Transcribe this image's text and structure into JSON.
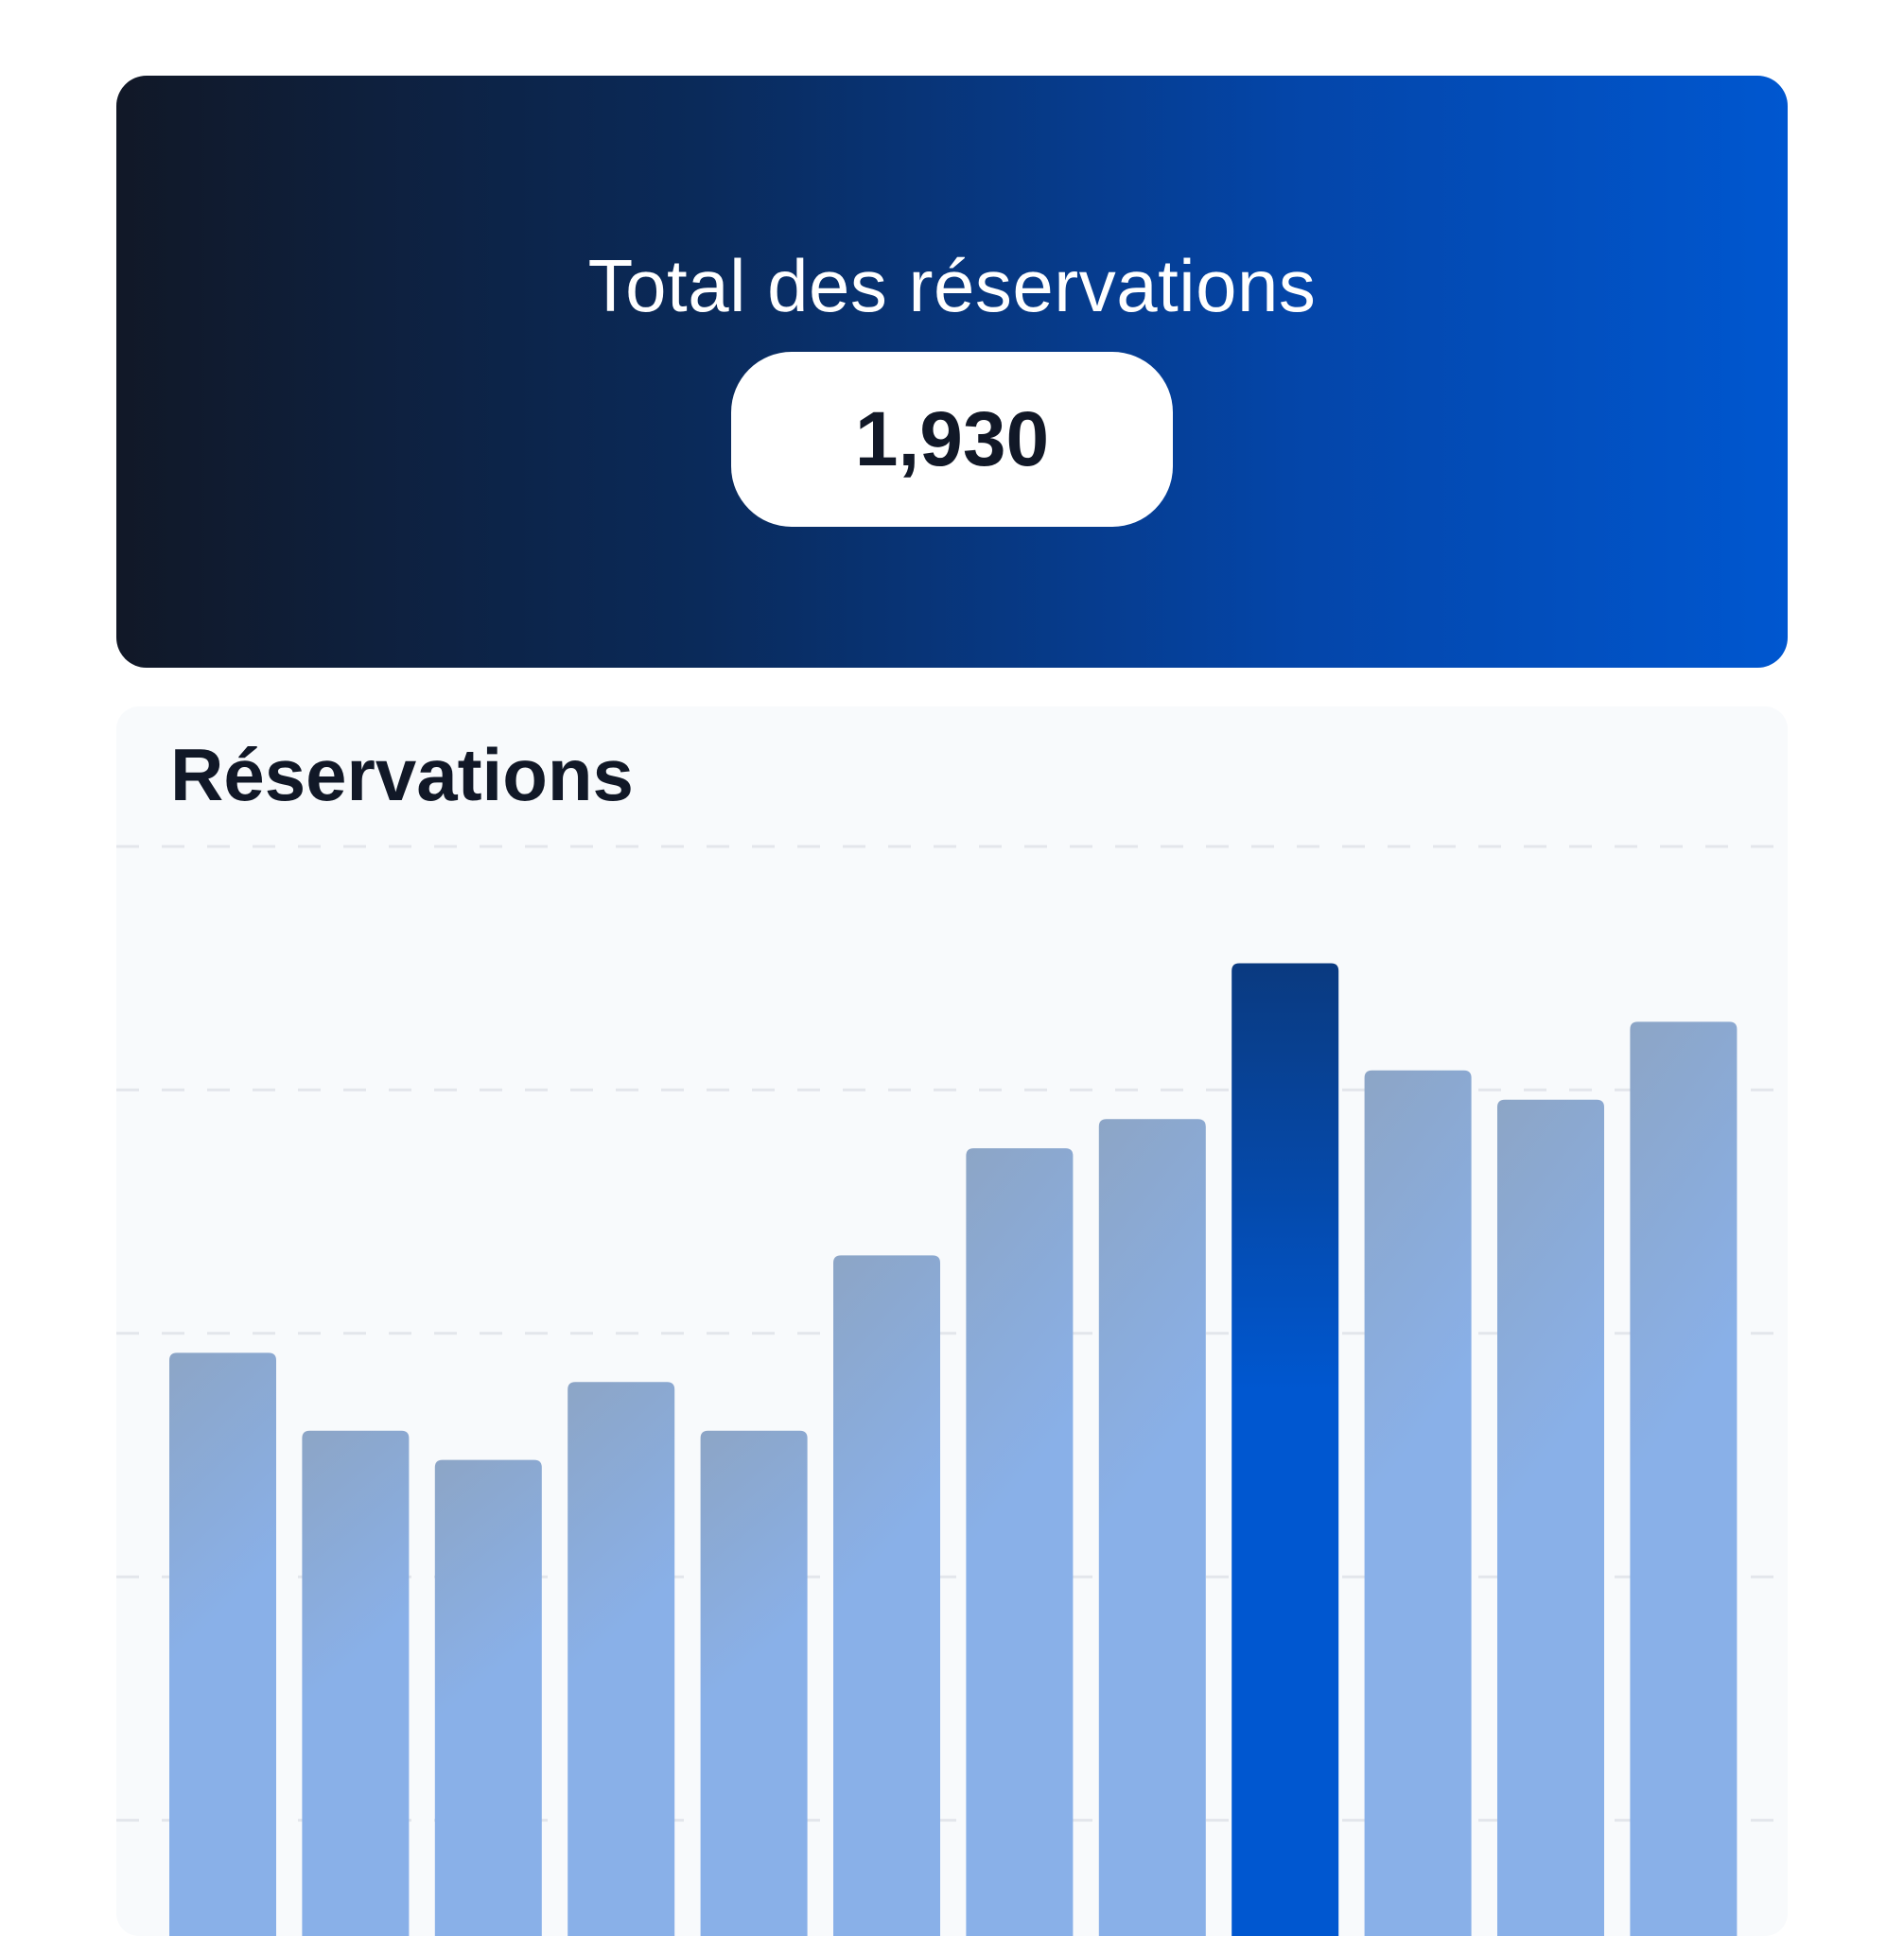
{
  "hero": {
    "title": "Total des réservations",
    "total": "1,930",
    "gradient": [
      "#111827",
      "#0057d0"
    ]
  },
  "chart_data": {
    "type": "bar",
    "title": "Réservations",
    "values": [
      148,
      140,
      137,
      145,
      140,
      158,
      169,
      172,
      188,
      177,
      174,
      182
    ],
    "highlight_index": 8,
    "ylim": [
      0,
      200
    ],
    "grid": true,
    "grid_step": 25,
    "colors": {
      "bar_top": "#8ca5c6",
      "bar_bottom": "#89b0e8",
      "highlight_top": "#0a3a80",
      "highlight_bottom": "#0057d0",
      "grid": "#e3e6eb"
    }
  }
}
